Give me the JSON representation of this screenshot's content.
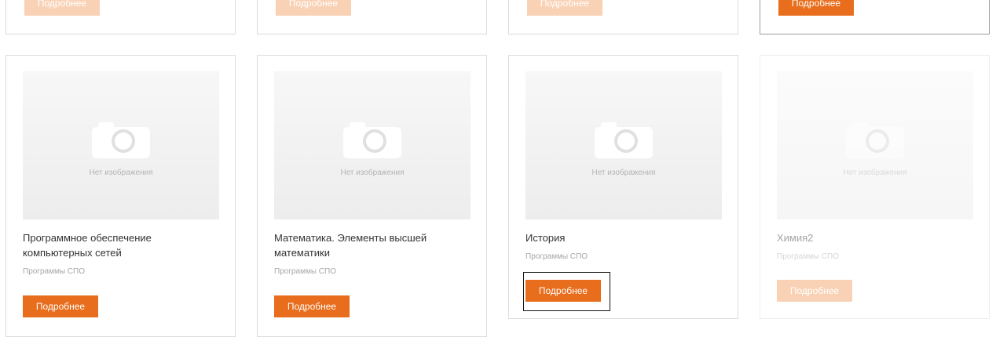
{
  "top_row": {
    "button_label": "Подробнее"
  },
  "courses": [
    {
      "title": "Программное обеспечение компьютерных сетей",
      "category": "Программы СПО",
      "button_label": "Подробнее",
      "thumb_label": "Нет изображения"
    },
    {
      "title": "Математика. Элементы высшей математики",
      "category": "Программы СПО",
      "button_label": "Подробнее",
      "thumb_label": "Нет изображения"
    },
    {
      "title": "История",
      "category": "Программы СПО",
      "button_label": "Подробнее",
      "thumb_label": "Нет изображения"
    },
    {
      "title": "Химия2",
      "category": "Программы СПО",
      "button_label": "Подробнее",
      "thumb_label": "Нет изображения"
    }
  ],
  "colors": {
    "accent": "#e86d1c",
    "accent_faded": "#f9d2b6",
    "card_border": "#dcdcdc",
    "text": "#333333",
    "muted": "#a6a6a6"
  },
  "icons": [
    "camera-icon"
  ]
}
